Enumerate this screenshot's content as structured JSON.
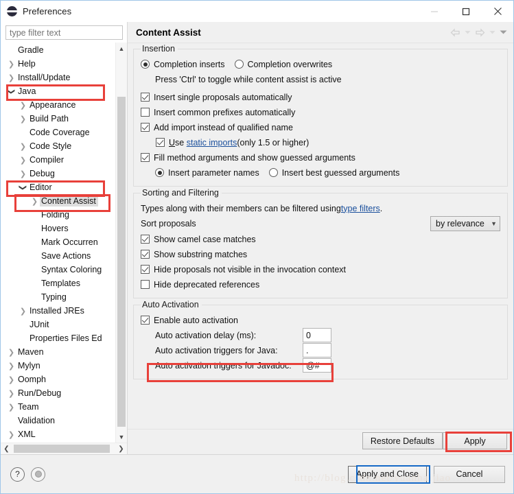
{
  "window": {
    "title": "Preferences",
    "icon": "eclipse-icon",
    "controls": {
      "minimize": "minimize-icon",
      "maximize": "maximize-icon",
      "close": "close-icon"
    }
  },
  "sidebar": {
    "filter_placeholder": "type filter text",
    "filter_value": "",
    "items": [
      {
        "label": "Gradle",
        "indent": 1,
        "twisty": "none",
        "selected": false
      },
      {
        "label": "Help",
        "indent": 1,
        "twisty": "collapsed",
        "selected": false
      },
      {
        "label": "Install/Update",
        "indent": 1,
        "twisty": "collapsed",
        "selected": false
      },
      {
        "label": "Java",
        "indent": 1,
        "twisty": "expanded",
        "selected": false
      },
      {
        "label": "Appearance",
        "indent": 2,
        "twisty": "collapsed",
        "selected": false
      },
      {
        "label": "Build Path",
        "indent": 2,
        "twisty": "collapsed",
        "selected": false
      },
      {
        "label": "Code Coverage",
        "indent": 2,
        "twisty": "none",
        "selected": false
      },
      {
        "label": "Code Style",
        "indent": 2,
        "twisty": "collapsed",
        "selected": false
      },
      {
        "label": "Compiler",
        "indent": 2,
        "twisty": "collapsed",
        "selected": false
      },
      {
        "label": "Debug",
        "indent": 2,
        "twisty": "collapsed",
        "selected": false
      },
      {
        "label": "Editor",
        "indent": 2,
        "twisty": "expanded",
        "selected": false
      },
      {
        "label": "Content Assist",
        "indent": 3,
        "twisty": "collapsed",
        "selected": true
      },
      {
        "label": "Folding",
        "indent": 3,
        "twisty": "none",
        "selected": false
      },
      {
        "label": "Hovers",
        "indent": 3,
        "twisty": "none",
        "selected": false
      },
      {
        "label": "Mark Occurren",
        "indent": 3,
        "twisty": "none",
        "selected": false
      },
      {
        "label": "Save Actions",
        "indent": 3,
        "twisty": "none",
        "selected": false
      },
      {
        "label": "Syntax Coloring",
        "indent": 3,
        "twisty": "none",
        "selected": false
      },
      {
        "label": "Templates",
        "indent": 3,
        "twisty": "none",
        "selected": false
      },
      {
        "label": "Typing",
        "indent": 3,
        "twisty": "none",
        "selected": false
      },
      {
        "label": "Installed JREs",
        "indent": 2,
        "twisty": "collapsed",
        "selected": false
      },
      {
        "label": "JUnit",
        "indent": 2,
        "twisty": "none",
        "selected": false
      },
      {
        "label": "Properties Files Ed",
        "indent": 2,
        "twisty": "none",
        "selected": false
      },
      {
        "label": "Maven",
        "indent": 1,
        "twisty": "collapsed",
        "selected": false
      },
      {
        "label": "Mylyn",
        "indent": 1,
        "twisty": "collapsed",
        "selected": false
      },
      {
        "label": "Oomph",
        "indent": 1,
        "twisty": "collapsed",
        "selected": false
      },
      {
        "label": "Run/Debug",
        "indent": 1,
        "twisty": "collapsed",
        "selected": false
      },
      {
        "label": "Team",
        "indent": 1,
        "twisty": "collapsed",
        "selected": false
      },
      {
        "label": "Validation",
        "indent": 1,
        "twisty": "none",
        "selected": false
      },
      {
        "label": "XML",
        "indent": 1,
        "twisty": "collapsed",
        "selected": false
      }
    ]
  },
  "page": {
    "title": "Content Assist",
    "nav": {
      "back": "back-arrow-icon",
      "back_menu": "chevron-down-icon",
      "forward": "forward-arrow-icon",
      "forward_menu": "chevron-down-icon",
      "view_menu": "chevron-down-icon"
    },
    "insertion": {
      "title": "Insertion",
      "completion_inserts": {
        "label": "Completion inserts",
        "checked": true
      },
      "completion_overwrites": {
        "label": "Completion overwrites",
        "checked": false
      },
      "hint": "Press 'Ctrl' to toggle while content assist is active",
      "insert_single_proposals": {
        "label": "Insert single proposals automatically",
        "checked": true
      },
      "insert_common_prefixes": {
        "label": "Insert common prefixes automatically",
        "checked": false
      },
      "add_import": {
        "label": "Add import instead of qualified name",
        "checked": true
      },
      "use_static_imports": {
        "checked": true,
        "prefix": "Use ",
        "link": "static imports",
        "suffix": " (only 1.5 or higher)"
      },
      "fill_method_arguments": {
        "label": "Fill method arguments and show guessed arguments",
        "checked": true
      },
      "insert_parameter_names": {
        "label": "Insert parameter names",
        "checked": true
      },
      "insert_best_guessed": {
        "label": "Insert best guessed arguments",
        "checked": false
      }
    },
    "sorting": {
      "title": "Sorting and Filtering",
      "desc_prefix": "Types along with their members can be filtered using ",
      "desc_link": "type filters",
      "desc_suffix": ".",
      "sort_label": "Sort proposals",
      "sort_value": "by relevance",
      "show_camel_case": {
        "label": "Show camel case matches",
        "checked": true
      },
      "show_substring": {
        "label": "Show substring matches",
        "checked": true
      },
      "hide_not_visible": {
        "label": "Hide proposals not visible in the invocation context",
        "checked": true
      },
      "hide_deprecated": {
        "label": "Hide deprecated references",
        "checked": false
      }
    },
    "auto_activation": {
      "title": "Auto Activation",
      "enable": {
        "label": "Enable auto activation",
        "checked": true
      },
      "delay_label": "Auto activation delay (ms):",
      "delay_value": "0",
      "java_label": "Auto activation triggers for Java:",
      "java_value": ".",
      "javadoc_label": "Auto activation triggers for Javadoc:",
      "javadoc_value": "@#"
    }
  },
  "buttons": {
    "restore_defaults": "Restore Defaults",
    "apply": "Apply",
    "apply_and_close": "Apply and Close",
    "cancel": "Cancel"
  },
  "footer": {
    "help_icon": "question-mark-icon",
    "disk_icon": "disk-icon"
  },
  "watermark": "http://blog.csdn.net/yuanhaijiao",
  "colors": {
    "annotation_red": "#e8403a",
    "focus_blue": "#1569c7",
    "link": "#1a4f9c",
    "selection": "#dedede"
  }
}
